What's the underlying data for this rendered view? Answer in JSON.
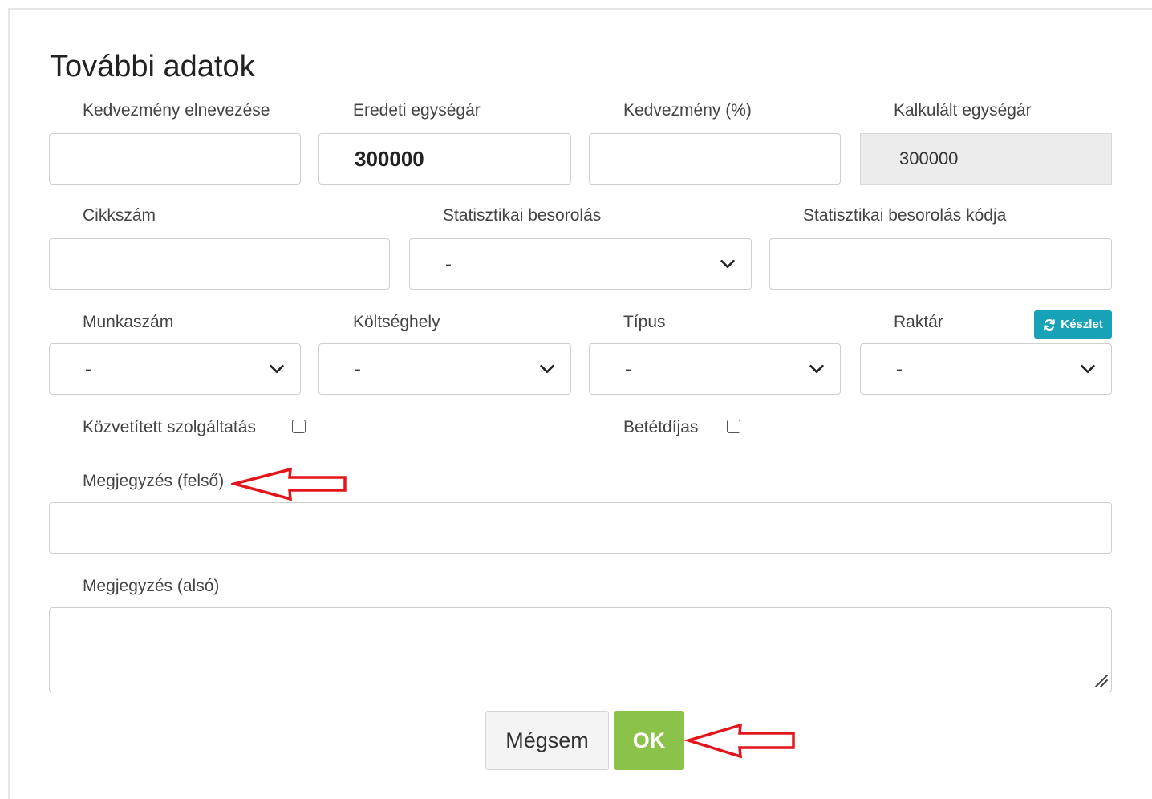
{
  "modal": {
    "title": "További adatok"
  },
  "labels": {
    "discount_name": "Kedvezmény elnevezése",
    "original_unit_price": "Eredeti egységár",
    "discount_percent": "Kedvezmény (%)",
    "calculated_unit_price": "Kalkulált egységár",
    "item_number": "Cikkszám",
    "stat_classification": "Statisztikai besorolás",
    "stat_classification_code": "Statisztikai besorolás kódja",
    "job_number": "Munkaszám",
    "cost_center": "Költséghely",
    "type": "Típus",
    "warehouse": "Raktár",
    "mediated_service": "Közvetített szolgáltatás",
    "deposit_fee": "Betétdíjas",
    "note_top": "Megjegyzés (felső)",
    "note_bottom": "Megjegyzés (alsó)"
  },
  "values": {
    "discount_name": "",
    "original_unit_price": "300000",
    "discount_percent": "",
    "calculated_unit_price": "300000",
    "item_number": "",
    "stat_classification": "-",
    "stat_classification_code": "",
    "job_number": "-",
    "cost_center": "-",
    "type": "-",
    "warehouse": "-",
    "note_top": "",
    "note_bottom": ""
  },
  "checkboxes": {
    "mediated_service": false,
    "deposit_fee": false
  },
  "buttons": {
    "stock": "Készlet",
    "cancel": "Mégsem",
    "ok": "OK"
  },
  "colors": {
    "ok_button": "#8bc34a",
    "stock_button": "#17a2b8",
    "annotation_arrow": "#e3151a"
  },
  "icons": {
    "stock": "refresh-icon",
    "select": "chevron-down-icon"
  }
}
